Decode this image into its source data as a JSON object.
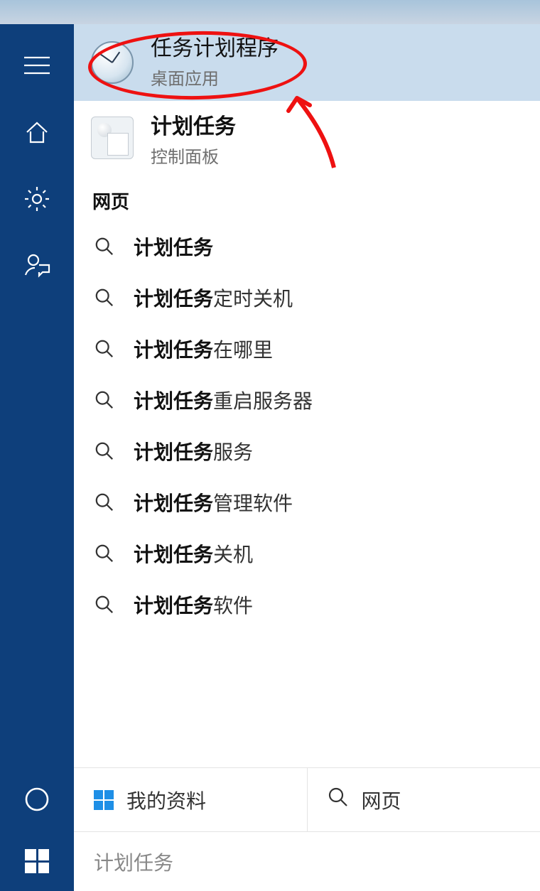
{
  "best_match": {
    "title": "任务计划程序",
    "subtitle": "桌面应用"
  },
  "second_result": {
    "title": "计划任务",
    "subtitle": "控制面板"
  },
  "web_section_label": "网页",
  "suggestions": [
    {
      "bold": "计划任务",
      "rest": ""
    },
    {
      "bold": "计划任务",
      "rest": " 定时关机"
    },
    {
      "bold": "计划任务",
      "rest": "在哪里"
    },
    {
      "bold": "计划任务",
      "rest": "重启服务器"
    },
    {
      "bold": "计划任务",
      "rest": "服务"
    },
    {
      "bold": "计划任务",
      "rest": "管理软件"
    },
    {
      "bold": "计划任务",
      "rest": " 关机"
    },
    {
      "bold": "计划任务",
      "rest": "软件"
    }
  ],
  "filters": {
    "mystuff": "我的资料",
    "web": "网页"
  },
  "search_value": "计划任务"
}
